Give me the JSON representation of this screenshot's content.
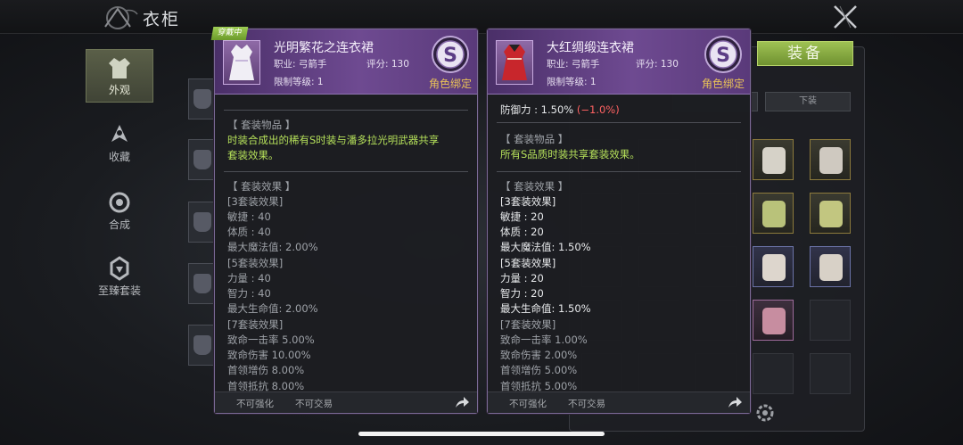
{
  "app": {
    "title": "衣柜"
  },
  "nav": [
    {
      "label": "外观",
      "icon": "outfit-icon",
      "active": true
    },
    {
      "label": "收藏",
      "icon": "favorites-icon",
      "active": false
    },
    {
      "label": "合成",
      "icon": "synthesis-icon",
      "active": false
    },
    {
      "label": "至臻套装",
      "icon": "premium-set-icon",
      "active": false
    }
  ],
  "inventory": {
    "equip_button": "装备",
    "filter_tab_lower": "下装"
  },
  "card_left": {
    "badge": "穿戴中",
    "name": "光明繁花之连衣裙",
    "class_label": "职业: 弓箭手",
    "score_label": "评分: 130",
    "level_label": "限制等级: 1",
    "grade": "S",
    "bind": "角色绑定",
    "set_items_header": "【 套装物品 】",
    "set_items_desc_1": "时装合成出的稀有S时装与潘多拉光明武器共享",
    "set_items_desc_2": "套装效果。",
    "set_effect_header": "【 套装效果 】",
    "lines": [
      "[3套装效果]",
      "敏捷 : 40",
      "体质 : 40",
      "最大魔法值:  2.00%",
      "[5套装效果]",
      "力量 : 40",
      "智力 : 40",
      "最大生命值:  2.00%",
      "[7套装效果]",
      "致命一击率 5.00%",
      "致命伤害 10.00%",
      "首领增伤 8.00%",
      "首领抵抗 8.00%"
    ],
    "foot_1": "不可强化",
    "foot_2": "不可交易"
  },
  "card_right": {
    "name": "大红绸缎连衣裙",
    "class_label": "职业: 弓箭手",
    "score_label": "评分: 130",
    "level_label": "限制等级: 1",
    "grade": "S",
    "bind": "角色绑定",
    "defense_label": "防御力 : 1.50%",
    "defense_diff": "(−1.0%)",
    "set_items_header": "【 套装物品 】",
    "set_items_desc_1": "所有S品质时装共享套装效果。",
    "set_effect_header": "【 套装效果 】",
    "lines": [
      "[3套装效果]",
      "敏捷 : 20",
      "体质 : 20",
      "最大魔法值:  1.50%",
      "[5套装效果]",
      "力量 : 20",
      "智力 : 20",
      "最大生命值:  1.50%",
      "[7套装效果]",
      "致命一击率 1.00%",
      "致命伤害 2.00%",
      "首领增伤 5.00%",
      "首领抵抗 5.00%"
    ],
    "foot_1": "不可强化",
    "foot_2": "不可交易"
  },
  "colors": {
    "accent_green": "#9fc254",
    "bind_gold": "#e9c257",
    "grade_purple": "#6e4a91",
    "desc_green": "#b5e05a",
    "diff_red": "#ff6262"
  }
}
